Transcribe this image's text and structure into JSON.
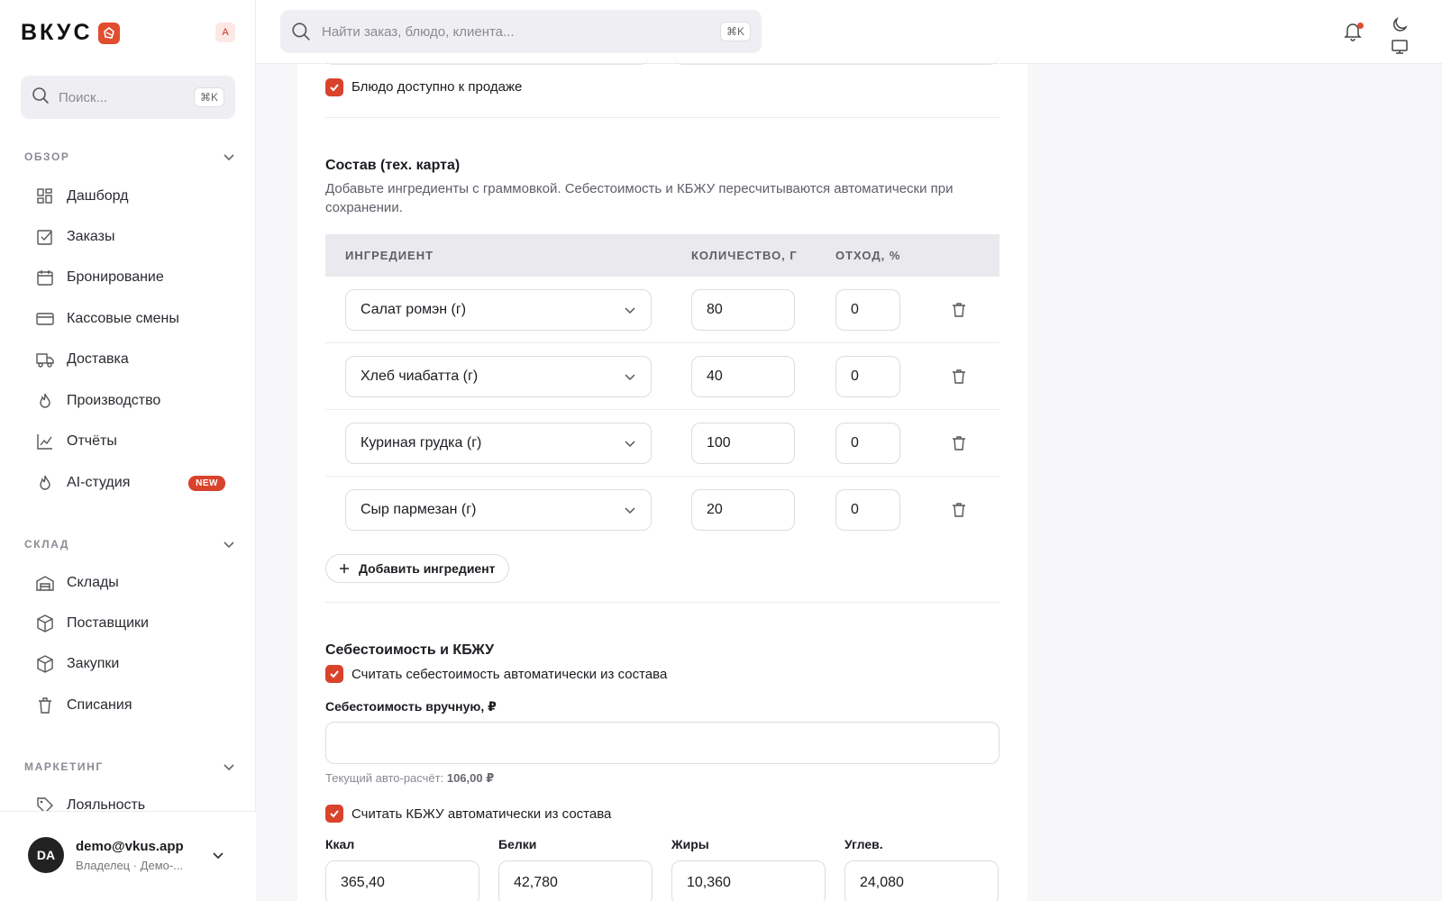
{
  "brand": {
    "name": "ВКУС",
    "workspace_badge": "A"
  },
  "sidebar": {
    "search_placeholder": "Поиск...",
    "search_kbd": "⌘K",
    "sections": {
      "overview": "ОБЗОР",
      "warehouse": "СКЛАД",
      "marketing": "МАРКЕТИНГ"
    },
    "items": [
      {
        "label": "Дашборд"
      },
      {
        "label": "Заказы"
      },
      {
        "label": "Бронирование"
      },
      {
        "label": "Кассовые смены"
      },
      {
        "label": "Доставка"
      },
      {
        "label": "Производство"
      },
      {
        "label": "Отчёты"
      },
      {
        "label": "AI-студия",
        "badge": "NEW"
      },
      {
        "label": "Склады"
      },
      {
        "label": "Поставщики"
      },
      {
        "label": "Закупки"
      },
      {
        "label": "Списания"
      },
      {
        "label": "Лояльность"
      }
    ],
    "user": {
      "initials": "DA",
      "email": "demo@vkus.app",
      "role": "Владелец · Демо-..."
    }
  },
  "topbar": {
    "search_placeholder": "Найти заказ, блюдо, клиента...",
    "search_kbd": "⌘K"
  },
  "form": {
    "available_label": "Блюдо доступно к продаже",
    "composition": {
      "title": "Состав (тех. карта)",
      "description": "Добавьте ингредиенты с граммовкой. Себестоимость и КБЖУ пересчитываются автоматически при сохранении.",
      "columns": [
        "ИНГРЕДИЕНТ",
        "КОЛИЧЕСТВО, Г",
        "ОТХОД, %"
      ],
      "rows": [
        {
          "ingredient": "Салат ромэн (г)",
          "qty": "80",
          "waste": "0"
        },
        {
          "ingredient": "Хлеб чиабатта (г)",
          "qty": "40",
          "waste": "0"
        },
        {
          "ingredient": "Куриная грудка (г)",
          "qty": "100",
          "waste": "0"
        },
        {
          "ingredient": "Сыр пармезан (г)",
          "qty": "20",
          "waste": "0"
        }
      ],
      "add_button": "Добавить ингредиент"
    },
    "cost": {
      "title": "Себестоимость и КБЖУ",
      "auto_cost_label": "Считать себестоимость автоматически из состава",
      "manual_cost_label": "Себестоимость вручную, ₽",
      "hint_prefix": "Текущий авто-расчёт:",
      "hint_value": "106,00 ₽",
      "auto_kbju_label": "Считать КБЖУ автоматически из состава",
      "kbju": [
        {
          "label": "Ккал",
          "value": "365,40"
        },
        {
          "label": "Белки",
          "value": "42,780"
        },
        {
          "label": "Жиры",
          "value": "10,360"
        },
        {
          "label": "Углев.",
          "value": "24,080"
        }
      ]
    }
  }
}
